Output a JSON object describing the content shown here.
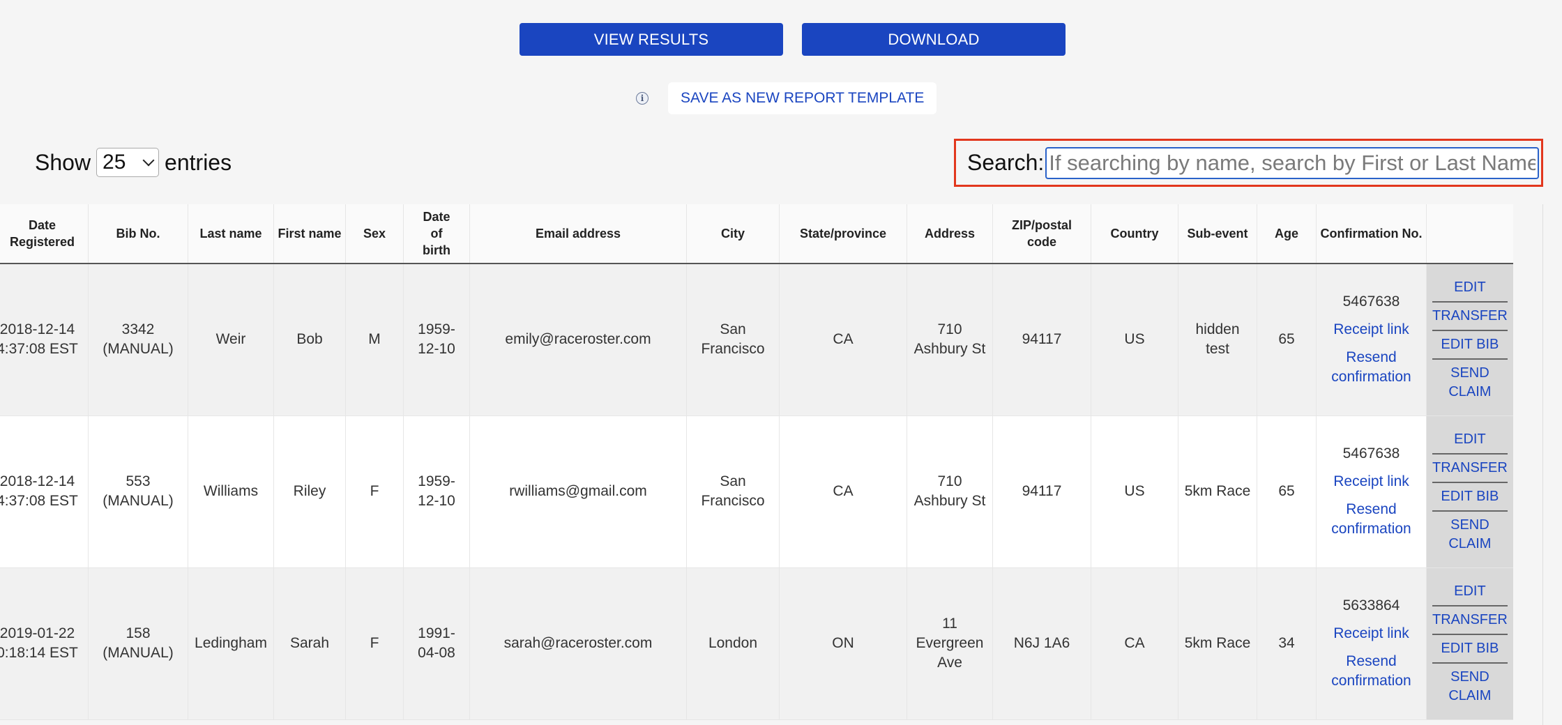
{
  "toolbar": {
    "view_results": "VIEW RESULTS",
    "download": "DOWNLOAD",
    "save_template": "SAVE AS NEW REPORT TEMPLATE",
    "info_icon": "i"
  },
  "length_menu": {
    "show": "Show",
    "value": "25",
    "entries": "entries"
  },
  "search": {
    "label": "Search:",
    "placeholder": "If searching by name, search by First or Last Name"
  },
  "table": {
    "headers": [
      "Date registered",
      "Bib No.",
      "Last name",
      "First name",
      "Sex",
      "Date of birth",
      "Email address",
      "City",
      "State/province",
      "Address",
      "ZIP/postal code",
      "Country",
      "Sub-event",
      "Age",
      "Confirmation No.",
      ""
    ],
    "header_display": {
      "date_registered": "Date\nRegistered",
      "date_of_birth": "Date\nof\nbirth"
    },
    "rows": [
      {
        "date": "2018-12-14 4:37:08 EST",
        "bib": "3342 (MANUAL)",
        "last": "Weir",
        "first": "Bob",
        "sex": "M",
        "dob": "1959-12-10",
        "email": "emily@raceroster.com",
        "city": "San Francisco",
        "state": "CA",
        "address": "710 Ashbury St",
        "zip": "94117",
        "country": "US",
        "subevent": "hidden test",
        "age": "65",
        "confirmation": "5467638",
        "receipt": "Receipt link",
        "resend": "Resend confirmation"
      },
      {
        "date": "2018-12-14 4:37:08 EST",
        "bib": "553 (MANUAL)",
        "last": "Williams",
        "first": "Riley",
        "sex": "F",
        "dob": "1959-12-10",
        "email": "rwilliams@gmail.com",
        "city": "San Francisco",
        "state": "CA",
        "address": "710 Ashbury St",
        "zip": "94117",
        "country": "US",
        "subevent": "5km Race",
        "age": "65",
        "confirmation": "5467638",
        "receipt": "Receipt link",
        "resend": "Resend confirmation"
      },
      {
        "date": "2019-01-22 0:18:14 EST",
        "bib": "158 (MANUAL)",
        "last": "Ledingham",
        "first": "Sarah",
        "sex": "F",
        "dob": "1991-04-08",
        "email": "sarah@raceroster.com",
        "city": "London",
        "state": "ON",
        "address": "11 Evergreen Ave",
        "zip": "N6J 1A6",
        "country": "CA",
        "subevent": "5km Race",
        "age": "34",
        "confirmation": "5633864",
        "receipt": "Receipt link",
        "resend": "Resend confirmation"
      }
    ],
    "actions": [
      "EDIT",
      "TRANSFER",
      "EDIT BIB",
      "SEND CLAIM"
    ]
  }
}
